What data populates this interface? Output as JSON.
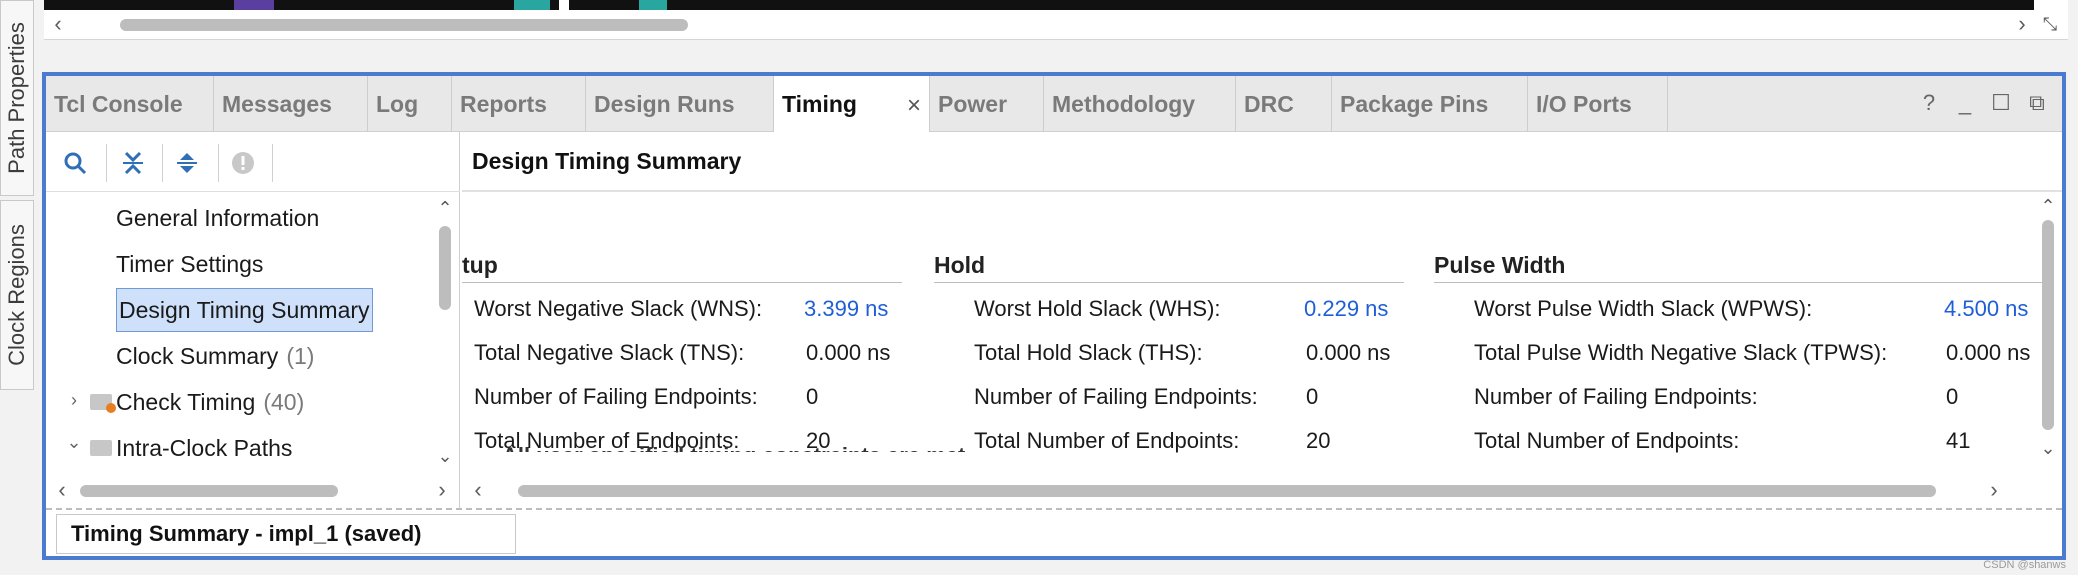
{
  "side_tabs": [
    "Path Properties",
    "Clock Regions"
  ],
  "tabs": [
    {
      "label": "Tcl Console",
      "active": false
    },
    {
      "label": "Messages",
      "active": false
    },
    {
      "label": "Log",
      "active": false
    },
    {
      "label": "Reports",
      "active": false
    },
    {
      "label": "Design Runs",
      "active": false
    },
    {
      "label": "Timing",
      "active": true,
      "close_glyph": "×"
    },
    {
      "label": "Power",
      "active": false
    },
    {
      "label": "Methodology",
      "active": false
    },
    {
      "label": "DRC",
      "active": false
    },
    {
      "label": "Package Pins",
      "active": false
    },
    {
      "label": "I/O Ports",
      "active": false
    }
  ],
  "window_controls": [
    {
      "name": "help-icon",
      "glyph": "?"
    },
    {
      "name": "minimize-icon",
      "glyph": "_"
    },
    {
      "name": "maximize-icon",
      "glyph": "☐"
    },
    {
      "name": "float-icon",
      "glyph": "⧉"
    }
  ],
  "toolbar": [
    {
      "name": "search-icon",
      "glyph": "🔍"
    },
    {
      "name": "collapse-all-icon",
      "glyph": "⇊"
    },
    {
      "name": "expand-all-icon",
      "glyph": "⇕"
    },
    {
      "name": "info-icon",
      "glyph": "●"
    }
  ],
  "nav_tree": [
    {
      "label": "General Information",
      "count": "",
      "selected": false
    },
    {
      "label": "Timer Settings",
      "count": "",
      "selected": false
    },
    {
      "label": "Design Timing Summary",
      "count": "",
      "selected": true
    },
    {
      "label": "Clock Summary",
      "count": "(1)",
      "selected": false
    },
    {
      "label": "Check Timing",
      "count": "(40)",
      "selected": false,
      "expander": "›"
    },
    {
      "label": "Intra-Clock Paths",
      "count": "",
      "selected": false,
      "expander": "⌄"
    }
  ],
  "content": {
    "title": "Design Timing Summary",
    "sections": [
      {
        "heading": "tup",
        "rows": [
          {
            "label": "Worst Negative Slack (WNS):",
            "value": "3.399 ns",
            "link": true
          },
          {
            "label": "Total Negative Slack (TNS):",
            "value": "0.000 ns",
            "link": false
          },
          {
            "label": "Number of Failing Endpoints:",
            "value": "0",
            "link": false
          },
          {
            "label": "Total Number of Endpoints:",
            "value": "20",
            "link": false
          }
        ]
      },
      {
        "heading": "Hold",
        "rows": [
          {
            "label": "Worst Hold Slack (WHS):",
            "value": "0.229 ns",
            "link": true
          },
          {
            "label": "Total Hold Slack (THS):",
            "value": "0.000 ns",
            "link": false
          },
          {
            "label": "Number of Failing Endpoints:",
            "value": "0",
            "link": false
          },
          {
            "label": "Total Number of Endpoints:",
            "value": "20",
            "link": false
          }
        ]
      },
      {
        "heading": "Pulse Width",
        "rows": [
          {
            "label": "Worst Pulse Width Slack (WPWS):",
            "value": "4.500 ns",
            "link": true
          },
          {
            "label": "Total Pulse Width Negative Slack (TPWS):",
            "value": "0.000 ns",
            "link": false
          },
          {
            "label": "Number of Failing Endpoints:",
            "value": "0",
            "link": false
          },
          {
            "label": "Total Number of Endpoints:",
            "value": "41",
            "link": false
          }
        ]
      }
    ],
    "cut_off_text": "All user specified timing constraints are met."
  },
  "status_tab": "Timing Summary - impl_1 (saved)",
  "watermark": "CSDN @shanws",
  "colors": {
    "accent_border": "#4a7bd0",
    "link": "#1f5fd6",
    "selection": "#cfe0fb"
  }
}
